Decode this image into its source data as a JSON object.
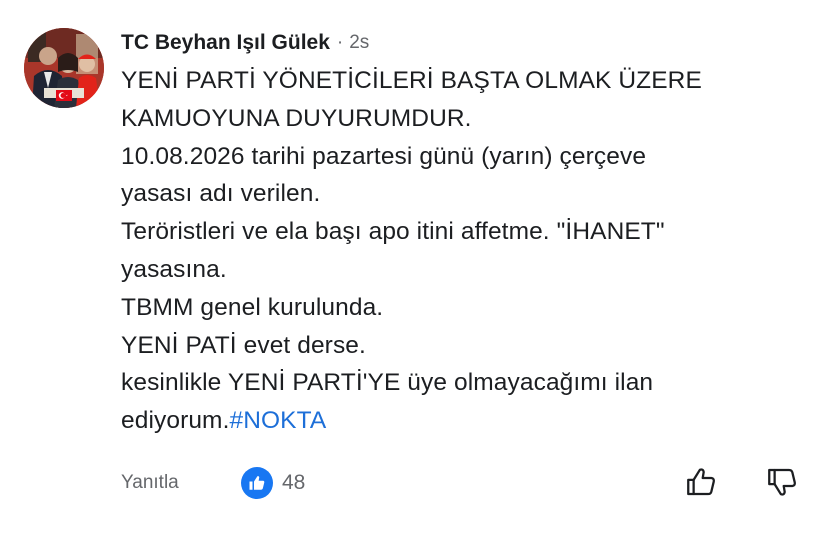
{
  "comment": {
    "author": "TC Beyhan Işıl Gülek",
    "separator": "·",
    "time": "2s",
    "lines": [
      "YENİ PARTİ YÖNETİCİLERİ BAŞTA OLMAK ÜZERE",
      "KAMUOYUNA DUYURUMDUR.",
      "10.08.2026 tarihi pazartesi günü (yarın) çerçeve",
      "yasası adı verilen.",
      "Teröristleri ve ela başı apo itini affetme. \"İHANET\"",
      "yasasına.",
      "TBMM genel kurulunda.",
      "YENİ PATİ evet derse.",
      "kesinlikle YENİ PARTİ'YE üye olmayacağımı ilan"
    ],
    "last_line_text": "ediyorum.",
    "hashtag": "#NOKTA"
  },
  "actions": {
    "reply_label": "Yanıtla",
    "like_count": "48"
  },
  "icons": {
    "avatar": "profile-photo",
    "like_badge": "thumbs-up-icon",
    "upvote": "thumbs-up-outline-icon",
    "downvote": "thumbs-down-outline-icon"
  },
  "colors": {
    "text": "#1c1e21",
    "secondary": "#65676b",
    "hashtag": "#1d6fd8",
    "like_badge": "#1877f2"
  }
}
